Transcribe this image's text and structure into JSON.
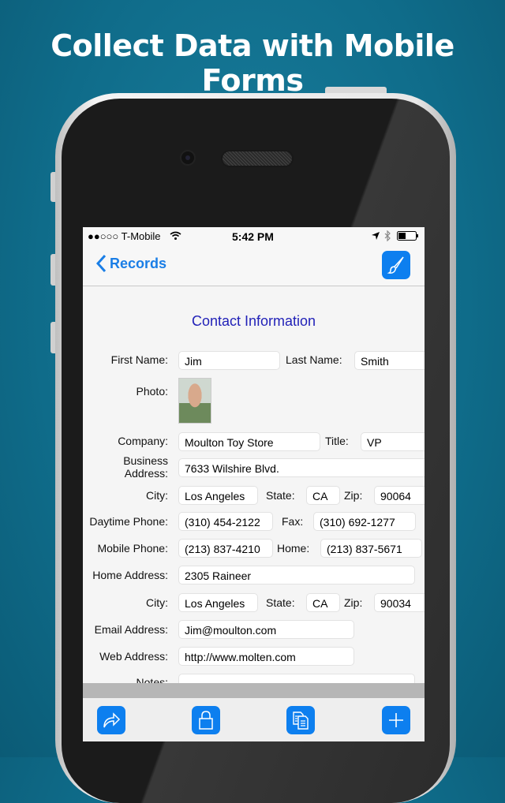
{
  "headline": "Collect Data with Mobile Forms",
  "status_bar": {
    "carrier": "●●○○○ T-Mobile",
    "time": "5:42 PM",
    "icons": [
      "wifi-icon",
      "location-icon",
      "bluetooth-icon",
      "battery-icon"
    ]
  },
  "nav": {
    "back_label": "Records",
    "edit_icon": "paintbrush-icon"
  },
  "form": {
    "title": "Contact Information",
    "first_name": {
      "label": "First Name:",
      "value": "Jim"
    },
    "last_name": {
      "label": "Last Name:",
      "value": "Smith"
    },
    "photo": {
      "label": "Photo:"
    },
    "company": {
      "label": "Company:",
      "value": "Moulton Toy Store"
    },
    "title_field": {
      "label": "Title:",
      "value": "VP"
    },
    "business_address": {
      "label_1": "Business",
      "label_2": "Address:",
      "value": "7633 Wilshire Blvd."
    },
    "business_city": {
      "label": "City:",
      "value": "Los Angeles"
    },
    "business_state": {
      "label": "State:",
      "value": "CA"
    },
    "business_zip": {
      "label": "Zip:",
      "value": "90064"
    },
    "daytime_phone": {
      "label": "Daytime Phone:",
      "value": "(310) 454-2122"
    },
    "fax": {
      "label": "Fax:",
      "value": "(310) 692-1277"
    },
    "mobile_phone": {
      "label": "Mobile Phone:",
      "value": "(213) 837-4210"
    },
    "home_phone": {
      "label": "Home:",
      "value": "(213) 837-5671"
    },
    "home_address": {
      "label": "Home Address:",
      "value": "2305 Raineer"
    },
    "home_city": {
      "label": "City:",
      "value": "Los Angeles"
    },
    "home_state": {
      "label": "State:",
      "value": "CA"
    },
    "home_zip": {
      "label": "Zip:",
      "value": "90034"
    },
    "email": {
      "label": "Email Address:",
      "value": "Jim@moulton.com"
    },
    "web": {
      "label": "Web Address:",
      "value": "http://www.molten.com"
    },
    "notes": {
      "label": "Notes:"
    }
  },
  "toolbar": {
    "buttons": [
      "share-icon",
      "lock-icon",
      "copy-icon",
      "plus-icon"
    ]
  },
  "colors": {
    "accent": "#0d7fef",
    "title": "#2222b8",
    "background": "#0f6c8a"
  }
}
